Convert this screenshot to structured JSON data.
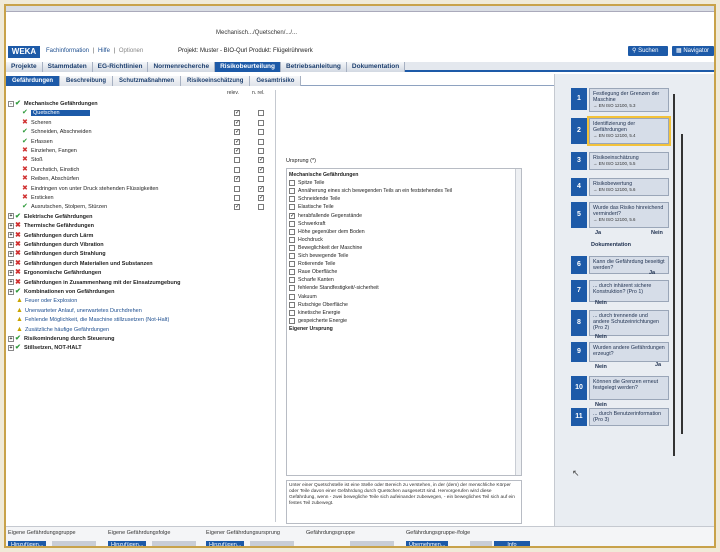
{
  "app": {
    "path": "Mechanisch.../Quetschen/.../...",
    "logo": "WEKA",
    "links": [
      "Fachinformation",
      "Hilfe",
      "Optionen"
    ],
    "project_line": "Projekt: Muster - BIO-Qurl Produkt: Flügelrührwerk",
    "search_label": "Suchen",
    "navigator_label": "Navigator"
  },
  "main_tabs": [
    {
      "label": "Projekte",
      "active": false
    },
    {
      "label": "Stammdaten",
      "active": false
    },
    {
      "label": "EG-Richtlinien",
      "active": false
    },
    {
      "label": "Normenrecherche",
      "active": false
    },
    {
      "label": "Risikobeurteilung",
      "active": true
    },
    {
      "label": "Betriebsanleitung",
      "active": false
    },
    {
      "label": "Dokumentation",
      "active": false
    }
  ],
  "sub_tabs": [
    {
      "label": "Gefährdungen",
      "active": true
    },
    {
      "label": "Beschreibung",
      "active": false
    },
    {
      "label": "Schutzmaßnahmen",
      "active": false
    },
    {
      "label": "Risikoeinschätzung",
      "active": false
    },
    {
      "label": "Gesamtrisiko",
      "active": false
    }
  ],
  "tree": {
    "col_relev": "relev.",
    "col_nrel": "n. rel.",
    "rows": [
      {
        "label": "Mechanische Gefährdungen",
        "level": 0,
        "mark": "ok",
        "bold": true,
        "expander": "-",
        "relev": false,
        "nrel": false
      },
      {
        "label": "Quetschen",
        "level": 1,
        "mark": "ok",
        "selected": true,
        "relev": true,
        "nrel": false
      },
      {
        "label": "Scheren",
        "level": 1,
        "mark": "no",
        "relev": true,
        "nrel": false
      },
      {
        "label": "Schneiden, Abschneiden",
        "level": 1,
        "mark": "ok",
        "relev": true,
        "nrel": false
      },
      {
        "label": "Erfassen",
        "level": 1,
        "mark": "ok",
        "relev": true,
        "nrel": false
      },
      {
        "label": "Einziehen, Fangen",
        "level": 1,
        "mark": "no",
        "relev": true,
        "nrel": false
      },
      {
        "label": "Stoß",
        "level": 1,
        "mark": "no",
        "relev": false,
        "nrel": true
      },
      {
        "label": "Durchstich, Einstich",
        "level": 1,
        "mark": "no",
        "relev": false,
        "nrel": true
      },
      {
        "label": "Reiben, Abschürfen",
        "level": 1,
        "mark": "no",
        "relev": true,
        "nrel": false
      },
      {
        "label": "Eindringen von unter Druck stehenden Flüssigkeiten",
        "level": 1,
        "mark": "no",
        "relev": false,
        "nrel": true
      },
      {
        "label": "Ersticken",
        "level": 1,
        "mark": "no",
        "relev": false,
        "nrel": true
      },
      {
        "label": "Ausrutschen, Stolpern, Stürzen",
        "level": 1,
        "mark": "ok",
        "relev": true,
        "nrel": false
      },
      {
        "label": "Elektrische Gefährdungen",
        "level": 0,
        "mark": "ok",
        "bold": true,
        "expander": "+"
      },
      {
        "label": "Thermische Gefährdungen",
        "level": 0,
        "mark": "no",
        "bold": true,
        "expander": "+"
      },
      {
        "label": "Gefährdungen durch Lärm",
        "level": 0,
        "mark": "no",
        "bold": true,
        "expander": "+"
      },
      {
        "label": "Gefährdungen durch Vibration",
        "level": 0,
        "mark": "no",
        "bold": true,
        "expander": "+"
      },
      {
        "label": "Gefährdungen durch Strahlung",
        "level": 0,
        "mark": "no",
        "bold": true,
        "expander": "+"
      },
      {
        "label": "Gefährdungen durch Materialien und Substanzen",
        "level": 0,
        "mark": "no",
        "bold": true,
        "expander": "+"
      },
      {
        "label": "Ergonomische Gefährdungen",
        "level": 0,
        "mark": "no",
        "bold": true,
        "expander": "+"
      },
      {
        "label": "Gefährdungen in Zusammenhang mit der Einsatzumgebung",
        "level": 0,
        "mark": "no",
        "bold": true,
        "expander": "+"
      },
      {
        "label": "Kombinationen von Gefährdungen",
        "level": 0,
        "mark": "ok",
        "bold": true,
        "expander": "+"
      },
      {
        "label": "Feuer oder Explosion",
        "level": 0,
        "mark": "warn",
        "blue": true
      },
      {
        "label": "Unerwarteter Anlauf, unerwartetes Durchdrehen",
        "level": 0,
        "mark": "warn",
        "blue": true
      },
      {
        "label": "Fehlende Möglichkeit, die Maschine stillzusetzen (Not-Halt)",
        "level": 0,
        "mark": "warn",
        "blue": true
      },
      {
        "label": "Zusätzliche häufige Gefährdungen",
        "level": 0,
        "mark": "warn",
        "blue": true
      },
      {
        "label": "Risikominderung durch Steuerung",
        "level": 0,
        "mark": "ok",
        "bold": true,
        "expander": "+"
      },
      {
        "label": "Stillsetzen, NOT-HALT",
        "level": 0,
        "mark": "ok",
        "bold": true,
        "expander": "+"
      }
    ]
  },
  "ursprung": {
    "label": "Ursprung (*)",
    "rows": [
      {
        "label": "Mechanische Gefährdungen",
        "head": true
      },
      {
        "label": "Spitze Teile",
        "checked": false
      },
      {
        "label": "Annäherung eines sich bewegenden Teils an ein feststehendes Teil",
        "checked": false
      },
      {
        "label": "Schneidende Teile",
        "checked": false
      },
      {
        "label": "Elastische Teile",
        "checked": false
      },
      {
        "label": "herabfallende Gegenstände",
        "checked": true
      },
      {
        "label": "Schwerkraft",
        "checked": false
      },
      {
        "label": "Höhe gegenüber dem Boden",
        "checked": false
      },
      {
        "label": "Hochdruck",
        "checked": false
      },
      {
        "label": "Beweglichkeit der Maschine",
        "checked": false
      },
      {
        "label": "Sich bewegende Teile",
        "checked": false
      },
      {
        "label": "Rotierende Teile",
        "checked": false
      },
      {
        "label": "Raue Oberfläche",
        "checked": false
      },
      {
        "label": "Scharfe Kanten",
        "checked": false
      },
      {
        "label": "fehlende Standfestigkeit/-sicherheit",
        "checked": false
      },
      {
        "label": "Vakuum",
        "checked": false
      },
      {
        "label": "Rutschige Oberfläche",
        "checked": false
      },
      {
        "label": "kinetische Energie",
        "checked": false
      },
      {
        "label": "gespeicherte Energie",
        "checked": false
      },
      {
        "label": "Eigener Ursprung",
        "head": true
      }
    ],
    "description": "Unter einer Quetschstelle ist eine Stelle oder Bereich zu verstehen, in der (dem) der menschliche Körper oder Teile davon einer Gefährdung durch Quetschen ausgesetzt sind. Hervorgerufen wird diese Gefährdung, wenn - zwei bewegliche Teile sich aufeinander zubewegen, - ein bewegliches Teil sich auf ein festes Teil zubewegt."
  },
  "flow": {
    "steps": [
      {
        "num": "1",
        "text": "Festlegung der Grenzen der Maschine",
        "ref": "→ EN ISO 12100, 5.3"
      },
      {
        "num": "2",
        "text": "Identifizierung der Gefährdungen",
        "ref": "→ EN ISO 12100, 5.4",
        "highlight": true
      },
      {
        "num": "3",
        "text": "Risikoeinschätzung",
        "ref": "→ EN ISO 12100, 5.5"
      },
      {
        "num": "4",
        "text": "Risikobewertung",
        "ref": "→ EN ISO 12100, 5.6"
      },
      {
        "num": "5",
        "text": "Wurde das Risiko hinreichend vermindert?",
        "ref": "→ EN ISO 12100, 5.6"
      },
      {
        "num": "6",
        "text": "Kann die Gefährdung beseitigt werden?",
        "ref": ""
      },
      {
        "num": "7",
        "text": "... durch inhärent sichere Konstruktion? (Pro 1)",
        "ref": ""
      },
      {
        "num": "8",
        "text": "... durch trennende und andere Schutzeinrichtungen (Pro 2)",
        "ref": ""
      },
      {
        "num": "9",
        "text": "Wurden andere Gefährdungen erzeugt?",
        "ref": ""
      },
      {
        "num": "10",
        "text": "Können die Grenzen erneut festgelegt werden?",
        "ref": ""
      },
      {
        "num": "11",
        "text": "... durch Benutzerinformation (Pro 3)",
        "ref": ""
      }
    ],
    "labels": {
      "ja": "Ja",
      "nein": "Nein",
      "dokumentation": "Dokumentation"
    }
  },
  "bottom": {
    "groups": [
      {
        "title": "Eigene Gefährdungsgruppe",
        "btn": "Hinzufügen...",
        "btn2": ""
      },
      {
        "title": "Eigene Gefährdungsfolge",
        "btn": "Hinzufügen...",
        "btn2": ""
      },
      {
        "title": "Eigener Gefährdungsursprung",
        "btn": "Hinzufügen...",
        "btn2": ""
      },
      {
        "title": "Gefährdungsgruppe",
        "btn": "",
        "btn2": ""
      },
      {
        "title": "Gefährdungsgruppe-/folge",
        "btn": "Übernehmen...",
        "btn2": ""
      }
    ],
    "info_label": "Info"
  }
}
